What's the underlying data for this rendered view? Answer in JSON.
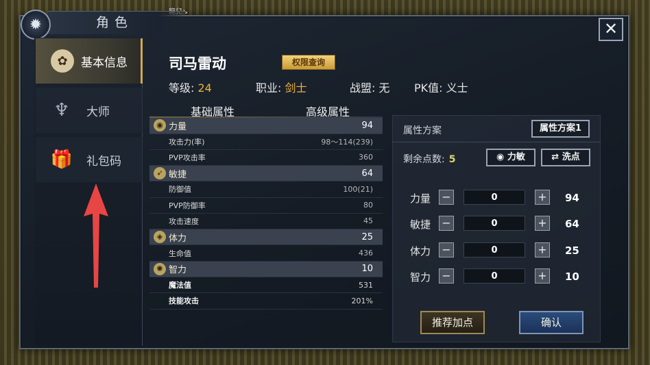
{
  "world": {
    "player_tag": "龍兒↘"
  },
  "window": {
    "title": "角色",
    "close_glyph": "✕"
  },
  "sidebar": {
    "items": [
      {
        "label": "基本信息",
        "icon": "character-icon",
        "glyph": "✿",
        "active": true
      },
      {
        "label": "大师",
        "icon": "winged-emblem-icon",
        "glyph": "♆"
      },
      {
        "label": "礼包码",
        "icon": "gift-box-icon",
        "glyph": "🎁"
      }
    ]
  },
  "character": {
    "name": "司马雷动",
    "permission_button": "权限查询",
    "level_label": "等级:",
    "level": "24",
    "class_label": "职业:",
    "class": "剑士",
    "alliance_label": "战盟:",
    "alliance": "无",
    "pk_label": "PK值:",
    "pk": "义士"
  },
  "attr_tabs": {
    "basic": "基础属性",
    "advanced": "高级属性"
  },
  "attributes": [
    {
      "type": "head",
      "name": "力量",
      "value": "94",
      "glyph": "◉"
    },
    {
      "type": "row",
      "name": "攻击力(率)",
      "value": "98～114(239)"
    },
    {
      "type": "row",
      "name": "PVP攻击率",
      "value": "360"
    },
    {
      "type": "head",
      "name": "敏捷",
      "value": "64",
      "glyph": "➶"
    },
    {
      "type": "row",
      "name": "防御值",
      "value": "100(21)"
    },
    {
      "type": "row",
      "name": "PVP防御率",
      "value": "80"
    },
    {
      "type": "row",
      "name": "攻击速度",
      "value": "45"
    },
    {
      "type": "head",
      "name": "体力",
      "value": "25",
      "glyph": "◈"
    },
    {
      "type": "row",
      "name": "生命值",
      "value": "436"
    },
    {
      "type": "head",
      "name": "智力",
      "value": "10",
      "glyph": "✺"
    },
    {
      "type": "bold",
      "name": "魔法值",
      "value": "531"
    },
    {
      "type": "bold",
      "name": "技能攻击",
      "value": "201%"
    }
  ],
  "scheme": {
    "label": "属性方案",
    "button": "属性方案1",
    "remaining_label": "剩余点数:",
    "remaining": "5",
    "strength_agility_button": "力敏",
    "reset_button": "洗点",
    "minus": "−",
    "plus": "+",
    "allocations": [
      {
        "name": "力量",
        "input": "0",
        "total": "94"
      },
      {
        "name": "敏捷",
        "input": "0",
        "total": "64"
      },
      {
        "name": "体力",
        "input": "0",
        "total": "25"
      },
      {
        "name": "智力",
        "input": "0",
        "total": "10"
      }
    ],
    "recommend_button": "推荐加点",
    "confirm_button": "确认"
  },
  "colors": {
    "accent_gold": "#f0b33a",
    "arrow_red": "#e84545"
  }
}
